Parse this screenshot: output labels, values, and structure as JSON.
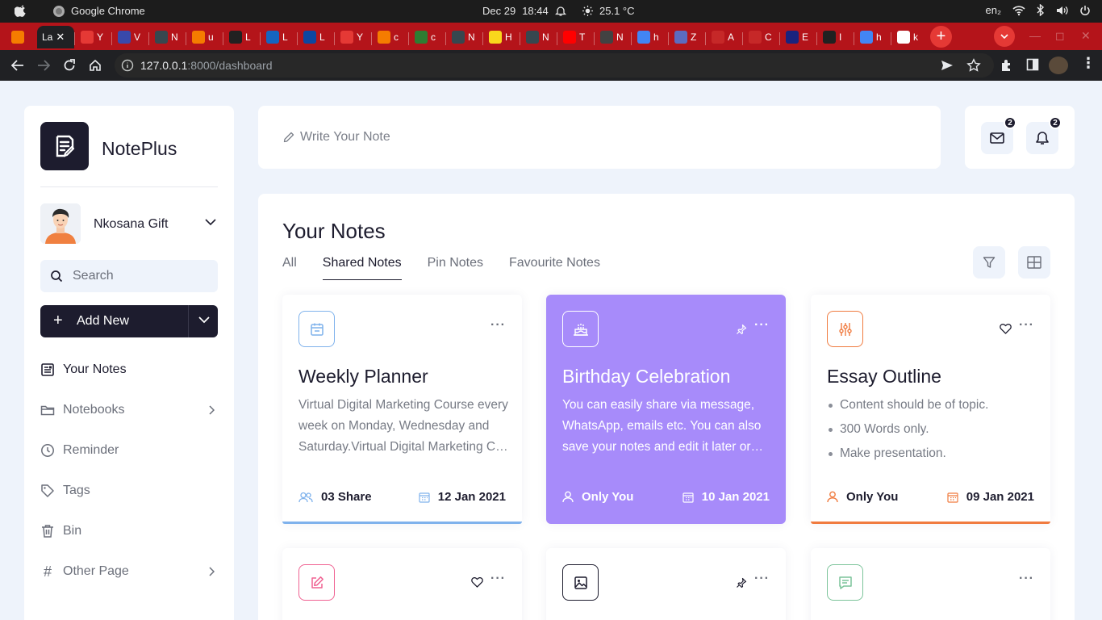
{
  "os": {
    "app_name": "Google Chrome",
    "date": "Dec 29",
    "time": "18:44",
    "temperature": "25.1 °C",
    "input_method": "en₂"
  },
  "browser": {
    "active_tab_title": "La",
    "tabs": [
      {
        "label": "Y",
        "color": "#e53935"
      },
      {
        "label": "V",
        "color": "#3949ab"
      },
      {
        "label": "N",
        "color": "#37474f"
      },
      {
        "label": "u",
        "color": "#f57c00"
      },
      {
        "label": "L",
        "color": "#212121"
      },
      {
        "label": "L",
        "color": "#1565c0"
      },
      {
        "label": "L",
        "color": "#0d47a1"
      },
      {
        "label": "Y",
        "color": "#e53935"
      },
      {
        "label": "c",
        "color": "#f57c00"
      },
      {
        "label": "c",
        "color": "#2e7d32"
      },
      {
        "label": "N",
        "color": "#37474f"
      },
      {
        "label": "H",
        "color": "#f9d71c"
      },
      {
        "label": "N",
        "color": "#37474f"
      },
      {
        "label": "T",
        "color": "#ff0000"
      },
      {
        "label": "N",
        "color": "#424242"
      },
      {
        "label": "h",
        "color": "#4285f4"
      },
      {
        "label": "Z",
        "color": "#5c6bc0"
      },
      {
        "label": "A",
        "color": "#c62828"
      },
      {
        "label": "C",
        "color": "#c62828"
      },
      {
        "label": "E",
        "color": "#1a237e"
      },
      {
        "label": "I",
        "color": "#212121"
      },
      {
        "label": "h",
        "color": "#4285f4"
      },
      {
        "label": "k",
        "color": "#ffffff"
      }
    ],
    "url_host": "127.0.0.1",
    "url_path": ":8000/dashboard"
  },
  "app": {
    "brand": "NotePlus",
    "user_name": "Nkosana Gift",
    "search_placeholder": "Search",
    "add_new_label": "Add New",
    "nav": [
      {
        "label": "Your Notes",
        "icon": "notes-icon",
        "active": true
      },
      {
        "label": "Notebooks",
        "icon": "folder-icon",
        "chevron": true
      },
      {
        "label": "Reminder",
        "icon": "clock-icon"
      },
      {
        "label": "Tags",
        "icon": "tag-icon"
      },
      {
        "label": "Bin",
        "icon": "trash-icon"
      },
      {
        "label": "Other Page",
        "icon": "hash-icon",
        "chevron": true
      }
    ],
    "note_placeholder": "Write Your Note",
    "mail_count": "2",
    "notification_count": "2"
  },
  "notes": {
    "title": "Your Notes",
    "tabs": [
      "All",
      "Shared Notes",
      "Pin Notes",
      "Favourite Notes"
    ],
    "active_tab": "Shared Notes",
    "cards": [
      {
        "title": "Weekly Planner",
        "icon": "calendar-icon",
        "body": "Virtual Digital Marketing Course every week on Monday, Wednesday and Saturday.Virtual Digital Marketing Course every week on Monday",
        "left_label": "03 Share",
        "left_icon": "users-icon",
        "date": "12 Jan 2021",
        "accent": "#7fb2ec"
      },
      {
        "title": "Birthday Celebration",
        "icon": "cake-icon",
        "body": "You can easily share via message, WhatsApp, emails etc. You can also save your notes and edit it later or can easily delete the note.",
        "left_label": "Only You",
        "left_icon": "user-icon",
        "date": "10 Jan 2021",
        "accent": "#a78bfa"
      },
      {
        "title": "Essay Outline",
        "icon": "sliders-icon",
        "bullets": [
          "Content should be of topic.",
          "300 Words only.",
          "Make presentation."
        ],
        "left_label": "Only You",
        "left_icon": "user-icon",
        "date": "09 Jan 2021",
        "accent": "#f07b3f"
      }
    ],
    "second_row_icons": [
      "edit-icon",
      "image-icon",
      "message-icon"
    ]
  }
}
